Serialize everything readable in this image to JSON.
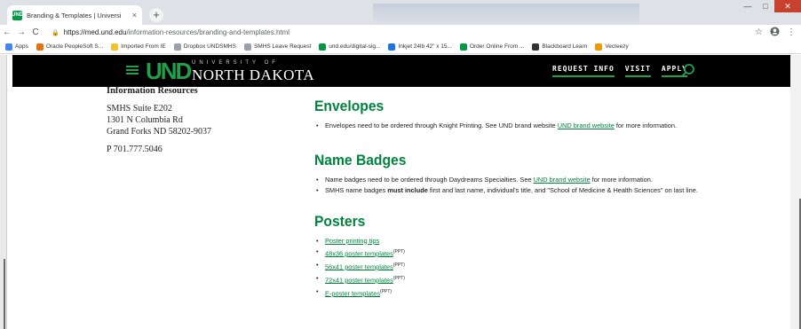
{
  "browser": {
    "tab_title": "Branding & Templates | Universi",
    "tab_close": "×",
    "new_tab": "+",
    "window_min": "—",
    "window_max": "□",
    "window_close": "✕",
    "back": "←",
    "forward": "→",
    "reload": "C",
    "url_host": "https://med.und.edu",
    "url_path": "/information-resources/branding-and-templates.html",
    "star": "☆",
    "menu": "⋮",
    "bookmarks": [
      {
        "label": "Apps",
        "color": "#4285f4"
      },
      {
        "label": "Oracle PeopleSoft S...",
        "color": "#e8710a"
      },
      {
        "label": "Imported From IE",
        "color": "#f6bf26"
      },
      {
        "label": "Dropbox UNDSMHS",
        "color": "#9aa0a6"
      },
      {
        "label": "SMHS Leave Request",
        "color": "#9aa0a6"
      },
      {
        "label": "und.edu/digital-sig...",
        "color": "#009a44"
      },
      {
        "label": "Inkjet 24lb 42\" x 15...",
        "color": "#1a73e8"
      },
      {
        "label": "Order Online From ...",
        "color": "#009a44"
      },
      {
        "label": "Blackboard Learn",
        "color": "#333333"
      },
      {
        "label": "Vecteezy",
        "color": "#f29900"
      }
    ]
  },
  "header": {
    "logo_mark": "UND",
    "logo_university": "UNIVERSITY OF",
    "logo_name": "NORTH DAKOTA",
    "links": [
      "REQUEST INFO",
      "VISIT",
      "APPLY"
    ],
    "accent": "#1fa14a"
  },
  "sidebar": {
    "heading": "Information Resources",
    "address": [
      "SMHS Suite E202",
      "1301 N Columbia Rd",
      "Grand Forks ND 58202-9037"
    ],
    "phone": "P 701.777.5046"
  },
  "main": {
    "envelopes": {
      "title": "Envelopes",
      "item_pre": "Envelopes need to be ordered through Knight Printing. See UND brand website ",
      "item_link": "UND brand website",
      "item_post": " for more information."
    },
    "badges": {
      "title": "Name Badges",
      "item1_pre": "Name badges need to be ordered through Daydreams Specialties. See ",
      "item1_link": "UND brand website",
      "item1_post": " for more information.",
      "item2_pre": "SMHS name badges ",
      "item2_bold": "must include",
      "item2_post": " first and last name, individual's title, and \"School of Medicine & Health Sciences\" on last line."
    },
    "posters": {
      "title": "Posters",
      "items": [
        {
          "label": "Poster printing tips",
          "sup": ""
        },
        {
          "label": "48x36 poster templates",
          "sup": "(PPT)"
        },
        {
          "label": "56x41 poster templates",
          "sup": "(PPT)"
        },
        {
          "label": "72x41 poster templates",
          "sup": "(PPT)"
        },
        {
          "label": "E-poster templates",
          "sup": "(PPT)"
        }
      ]
    },
    "link_color": "#00843d"
  }
}
